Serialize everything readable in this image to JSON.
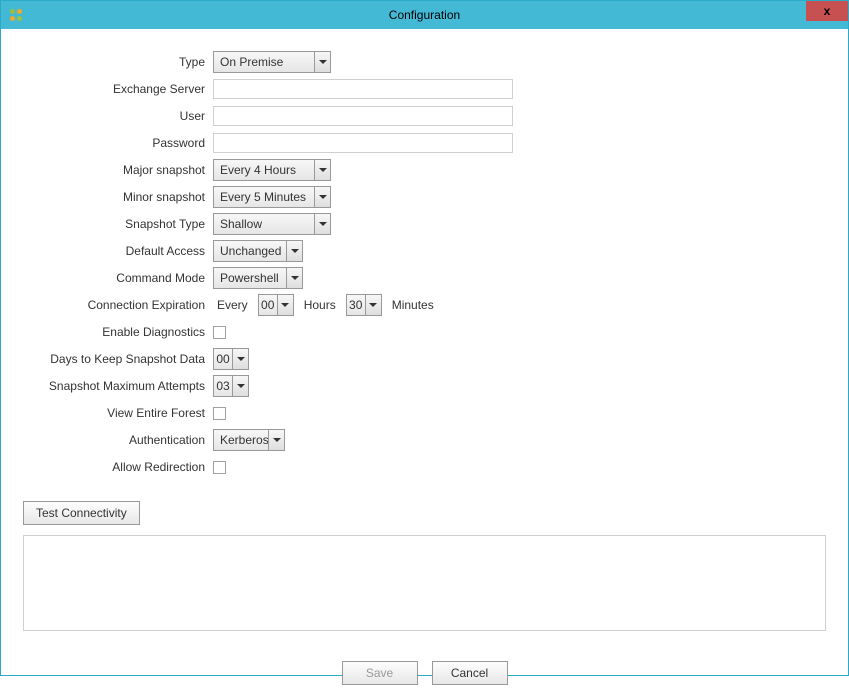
{
  "titlebar": {
    "title": "Configuration",
    "close_symbol": "x"
  },
  "form": {
    "type_label": "Type",
    "type_value": "On Premise",
    "exchange_server_label": "Exchange Server",
    "exchange_server_value": "",
    "user_label": "User",
    "user_value": "",
    "password_label": "Password",
    "password_value": "",
    "major_snapshot_label": "Major snapshot",
    "major_snapshot_value": "Every 4 Hours",
    "minor_snapshot_label": "Minor snapshot",
    "minor_snapshot_value": "Every 5 Minutes",
    "snapshot_type_label": "Snapshot Type",
    "snapshot_type_value": "Shallow",
    "default_access_label": "Default Access",
    "default_access_value": "Unchanged",
    "command_mode_label": "Command Mode",
    "command_mode_value": "Powershell",
    "connection_expiration_label": "Connection Expiration",
    "connection_every_text": "Every",
    "connection_hours_value": "00",
    "connection_hours_text": "Hours",
    "connection_minutes_value": "30",
    "connection_minutes_text": "Minutes",
    "enable_diagnostics_label": "Enable Diagnostics",
    "days_keep_label": "Days to Keep Snapshot Data",
    "days_keep_value": "00",
    "max_attempts_label": "Snapshot Maximum Attempts",
    "max_attempts_value": "03",
    "view_forest_label": "View Entire Forest",
    "authentication_label": "Authentication",
    "authentication_value": "Kerberos",
    "allow_redirection_label": "Allow Redirection"
  },
  "actions": {
    "test_connectivity": "Test Connectivity",
    "save": "Save",
    "cancel": "Cancel"
  }
}
